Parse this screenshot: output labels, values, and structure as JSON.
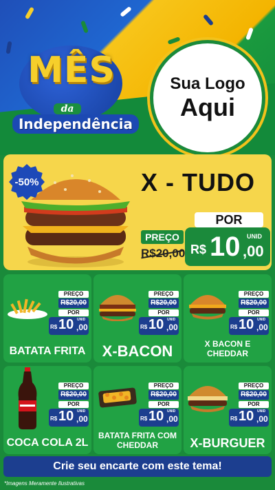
{
  "header": {
    "title_main": "MÊS",
    "title_da": "da",
    "title_sub": "Independência",
    "logo_line1": "Sua Logo",
    "logo_line2": "Aqui"
  },
  "feature": {
    "discount": "-50%",
    "name": "X - TUDO",
    "preco_label": "PREÇO",
    "old_price": "R$20,00",
    "por_label": "POR",
    "unid_label": "UNID",
    "currency": "R$",
    "price_main": "10",
    "price_cents": ",00"
  },
  "products": [
    {
      "name": "BATATA FRITA",
      "preco": "PREÇO",
      "old": "R$20,00",
      "por": "POR",
      "unid": "UNID",
      "currency": "R$",
      "main": "10",
      "cents": ",00"
    },
    {
      "name": "X-BACON",
      "preco": "PREÇO",
      "old": "R$20,00",
      "por": "POR",
      "unid": "UNID",
      "currency": "R$",
      "main": "10",
      "cents": ",00"
    },
    {
      "name": "X BACON E CHEDDAR",
      "preco": "PREÇO",
      "old": "R$20,00",
      "por": "POR",
      "unid": "UNID",
      "currency": "R$",
      "main": "10",
      "cents": ",00"
    },
    {
      "name": "COCA COLA 2L",
      "preco": "PREÇO",
      "old": "R$20,00",
      "por": "POR",
      "unid": "UNID",
      "currency": "R$",
      "main": "10",
      "cents": ",00"
    },
    {
      "name": "BATATA FRITA COM CHEDDAR",
      "preco": "PREÇO",
      "old": "R$20,00",
      "por": "POR",
      "unid": "UNID",
      "currency": "R$",
      "main": "10",
      "cents": ",00"
    },
    {
      "name": "X-BURGUER",
      "preco": "PREÇO",
      "old": "R$20,00",
      "por": "POR",
      "unid": "UNID",
      "currency": "R$",
      "main": "10",
      "cents": ",00"
    }
  ],
  "cta": "Crie seu encarte com este tema!",
  "disclaimer": "*Imagens Meramente Ilustrativas",
  "colors": {
    "brazil_green": "#1a8a3a",
    "brazil_yellow": "#f6d64b",
    "brazil_blue": "#1c3e8f"
  }
}
